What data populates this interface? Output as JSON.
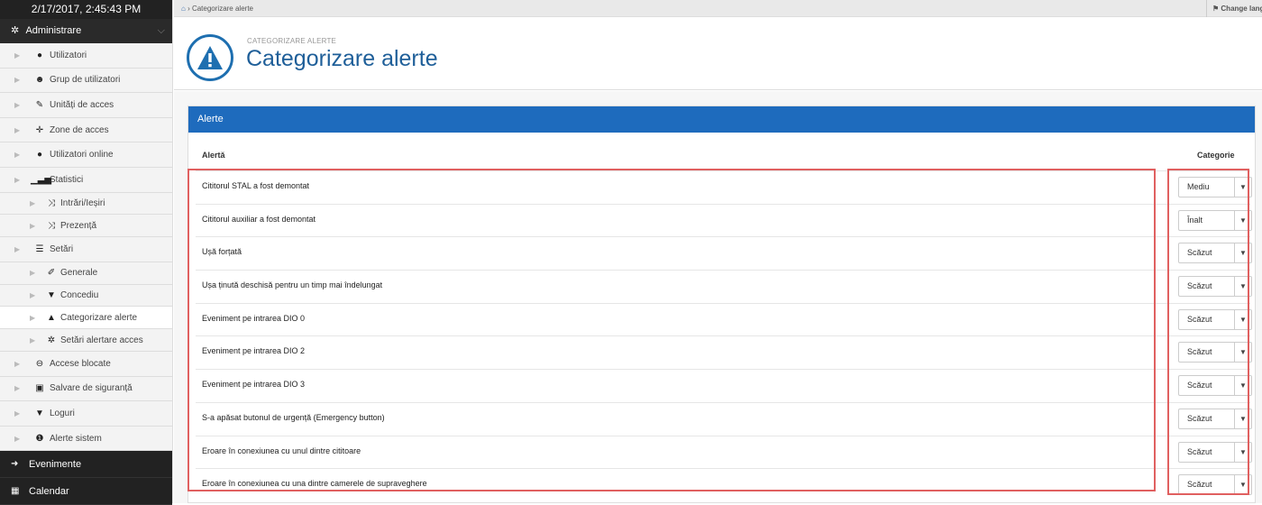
{
  "clock": "2/17/2017, 2:45:43 PM",
  "admin": {
    "label": "Administrare"
  },
  "menu": [
    {
      "label": "Utilizatori",
      "icon": "user-icon"
    },
    {
      "label": "Grup de utilizatori",
      "icon": "users-icon"
    },
    {
      "label": "Unități de acces",
      "icon": "pen-icon"
    },
    {
      "label": "Zone de acces",
      "icon": "crosshair-icon"
    },
    {
      "label": "Utilizatori online",
      "icon": "user-online-icon"
    },
    {
      "label": "Statistici",
      "icon": "signal-icon"
    }
  ],
  "stats_sub": [
    {
      "label": "Intrări/Ieșiri",
      "icon": "shuffle-icon"
    },
    {
      "label": "Prezență",
      "icon": "shuffle-icon"
    }
  ],
  "settings": {
    "label": "Setări",
    "icon": "list-icon"
  },
  "settings_sub": [
    {
      "label": "Generale",
      "icon": "wrench-icon"
    },
    {
      "label": "Concediu",
      "icon": "filter-icon"
    },
    {
      "label": "Categorizare alerte",
      "icon": "warning-icon"
    },
    {
      "label": "Setări alertare acces",
      "icon": "gear-icon"
    }
  ],
  "menu2": [
    {
      "label": "Accese blocate",
      "icon": "block-icon"
    },
    {
      "label": "Salvare de siguranță",
      "icon": "save-icon"
    },
    {
      "label": "Loguri",
      "icon": "filter-icon"
    },
    {
      "label": "Alerte sistem",
      "icon": "info-icon"
    }
  ],
  "bottom": [
    {
      "label": "Evenimente",
      "icon": "sign-in-icon"
    },
    {
      "label": "Calendar",
      "icon": "calendar-icon"
    }
  ],
  "breadcrumb": {
    "current": "Categorizare alerte"
  },
  "lang": "Change langu",
  "header": {
    "small": "CATEGORIZARE ALERTE",
    "title": "Categorizare alerte"
  },
  "panel": {
    "title": "Alerte",
    "col_alert": "Alertă",
    "col_category": "Categorie"
  },
  "alerts": [
    {
      "text": "Cititorul STAL a fost demontat",
      "category": "Mediu"
    },
    {
      "text": "Cititorul auxiliar a fost demontat",
      "category": "Înalt"
    },
    {
      "text": "Ușă forțată",
      "category": "Scăzut"
    },
    {
      "text": "Ușa ținută deschisă pentru un timp mai îndelungat",
      "category": "Scăzut"
    },
    {
      "text": "Eveniment pe intrarea DIO 0",
      "category": "Scăzut"
    },
    {
      "text": "Eveniment pe intrarea DIO 2",
      "category": "Scăzut"
    },
    {
      "text": "Eveniment pe intrarea DIO 3",
      "category": "Scăzut"
    },
    {
      "text": "S-a apăsat butonul de urgență (Emergency button)",
      "category": "Scăzut"
    },
    {
      "text": "Eroare în conexiunea cu unul dintre cititoare",
      "category": "Scăzut"
    },
    {
      "text": "Eroare în conexiunea cu una dintre camerele de supraveghere",
      "category": "Scăzut"
    }
  ]
}
